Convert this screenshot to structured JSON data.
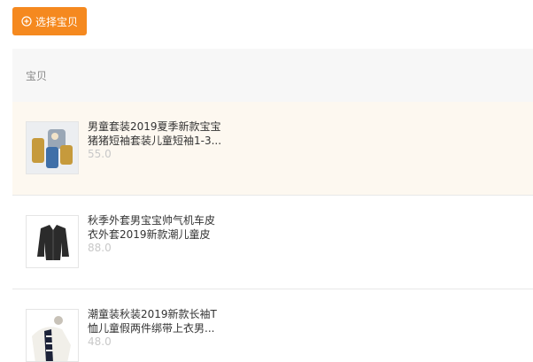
{
  "toolbar": {
    "select_label": "选择宝贝"
  },
  "table": {
    "header": "宝贝",
    "rows": [
      {
        "title": "男童套装2019夏季新款宝宝猪猪短袖套装儿童短袖1-3...",
        "price": "55.0"
      },
      {
        "title": "秋季外套男宝宝帅气机车皮衣外套2019新款潮儿童皮 ...",
        "price": "88.0"
      },
      {
        "title": "潮童装秋装2019新款长袖T恤儿童假两件绑带上衣男...",
        "price": "48.0"
      }
    ]
  },
  "colors": {
    "accent": "#f5891f",
    "highlight_row": "#fdf8f0",
    "header_bg": "#f7f7f7"
  }
}
